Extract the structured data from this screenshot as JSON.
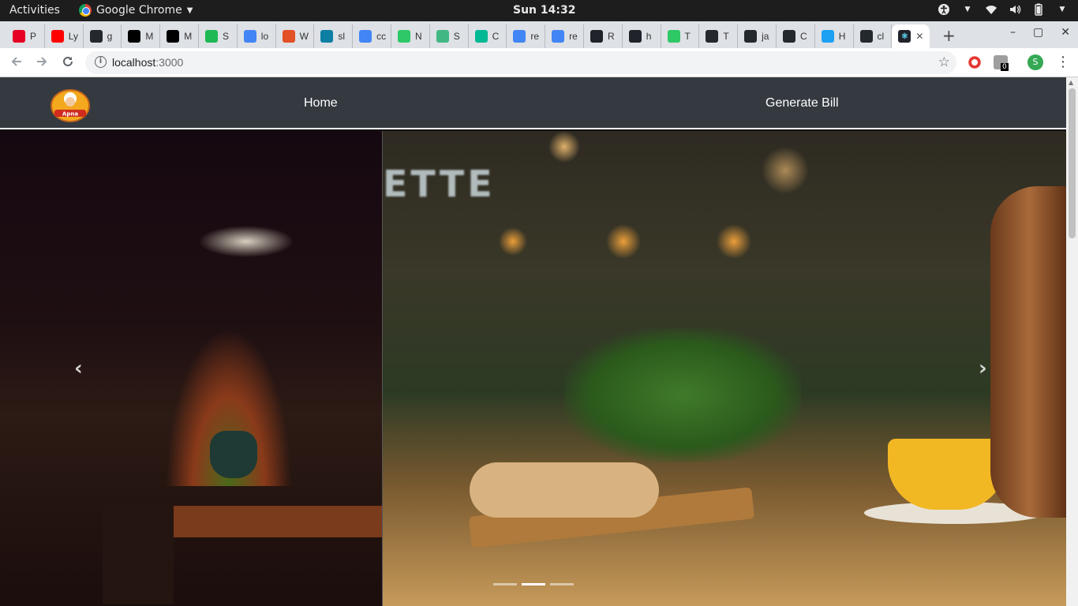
{
  "system_bar": {
    "activities_label": "Activities",
    "app_name": "Google Chrome",
    "clock": "Sun 14:32",
    "icons": [
      "accessibility-icon",
      "wifi-icon",
      "volume-icon",
      "battery-icon"
    ]
  },
  "browser": {
    "tabs": [
      {
        "favicon": "pinterest-icon",
        "label": "P",
        "color": "#e60023"
      },
      {
        "favicon": "youtube-icon",
        "label": "Ly",
        "color": "#ff0000"
      },
      {
        "favicon": "github-icon",
        "label": "g",
        "color": "#24292e"
      },
      {
        "favicon": "medium-icon",
        "label": "M",
        "color": "#000000"
      },
      {
        "favicon": "medium-icon",
        "label": "M",
        "color": "#000000"
      },
      {
        "favicon": "spotify-icon",
        "label": "S",
        "color": "#1db954"
      },
      {
        "favicon": "google-icon",
        "label": "lo",
        "color": "#4285f4"
      },
      {
        "favicon": "html5-icon",
        "label": "W",
        "color": "#e34f26"
      },
      {
        "favicon": "mongo-icon",
        "label": "sl",
        "color": "#0d7fa3"
      },
      {
        "favicon": "google-icon",
        "label": "cc",
        "color": "#4285f4"
      },
      {
        "favicon": "hackerrank-icon",
        "label": "N",
        "color": "#2ec866"
      },
      {
        "favicon": "vue-icon",
        "label": "S",
        "color": "#41b883"
      },
      {
        "favicon": "diamond-icon",
        "label": "C",
        "color": "#00b894"
      },
      {
        "favicon": "google-icon",
        "label": "re",
        "color": "#4285f4"
      },
      {
        "favicon": "google-icon",
        "label": "re",
        "color": "#4285f4"
      },
      {
        "favicon": "react-icon",
        "label": "R",
        "color": "#20232a"
      },
      {
        "favicon": "react-icon",
        "label": "h",
        "color": "#20232a"
      },
      {
        "favicon": "hackerrank-icon",
        "label": "T",
        "color": "#2ec866"
      },
      {
        "favicon": "github-icon",
        "label": "T",
        "color": "#24292e"
      },
      {
        "favicon": "github-icon",
        "label": "ja",
        "color": "#24292e"
      },
      {
        "favicon": "github-icon",
        "label": "C",
        "color": "#24292e"
      },
      {
        "favicon": "twitter-icon",
        "label": "H",
        "color": "#1da1f2"
      },
      {
        "favicon": "github-icon",
        "label": "cl",
        "color": "#24292e"
      }
    ],
    "active_tab": {
      "favicon": "react-icon",
      "close_glyph": "✕"
    },
    "new_tab_glyph": "+",
    "window_controls": [
      "–",
      "▢",
      "✕"
    ],
    "url_host": "localhost",
    "url_port": ":3000",
    "extension_badge": "0",
    "profile_initial": "S"
  },
  "site": {
    "logo_alt": "Apna Restaurant logo",
    "nav": {
      "home_label": "Home",
      "generate_bill_label": "Generate Bill"
    },
    "carousel": {
      "prev_glyph": "‹",
      "next_glyph": "›",
      "sign_text": "ETTE",
      "slide_count": 3,
      "active_slide": 2
    }
  }
}
